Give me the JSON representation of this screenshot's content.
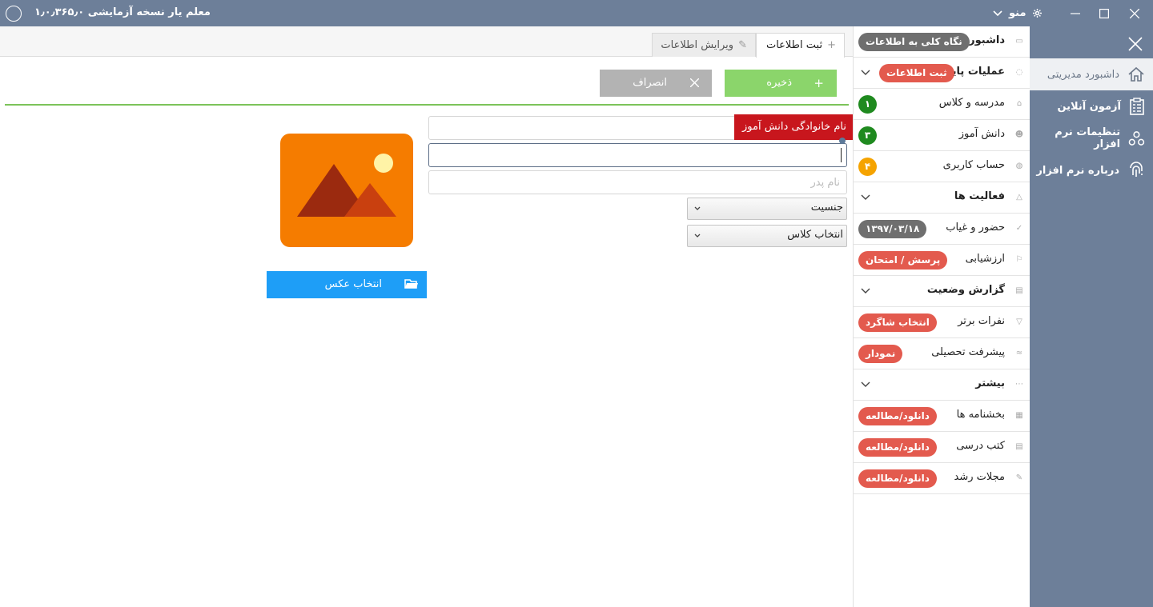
{
  "titlebar": {
    "title": "معلم یار نسخه آزمایشی ۱٫۰٫۳۶۵٫۰",
    "menu_label": "منو"
  },
  "rail": {
    "items": [
      {
        "label": "داشبورد مدیریتی",
        "icon": "home-icon",
        "active": true
      },
      {
        "label": "آزمون آنلاین",
        "icon": "clipboard-icon",
        "active": false
      },
      {
        "label": "تنظیمات نرم افزار",
        "icon": "cogs-icon",
        "active": false
      },
      {
        "label": "درباره نرم افزار",
        "icon": "fingerprint-icon",
        "active": false
      }
    ]
  },
  "sidemenu": {
    "rows": [
      {
        "label": "داشبورد",
        "badge": "نگاه کلی به اطلاعات",
        "badge_color": "gray",
        "head": true
      },
      {
        "label": "عملیات پایه",
        "badge": "ثبت اطلاعات",
        "badge_color": "red",
        "head": true,
        "chevron": true
      },
      {
        "label": "مدرسه و کلاس",
        "badge": "۱",
        "badge_color": "green"
      },
      {
        "label": "دانش آموز",
        "badge": "۳",
        "badge_color": "green"
      },
      {
        "label": "حساب کاربری",
        "badge": "۴",
        "badge_color": "orange"
      },
      {
        "label": "فعالیت ها",
        "head": true,
        "chevron": true
      },
      {
        "label": "حضور و غیاب",
        "badge": "۱۳۹۷/۰۳/۱۸",
        "badge_color": "gray"
      },
      {
        "label": "ارزشیابی",
        "badge": "پرسش / امتحان",
        "badge_color": "red"
      },
      {
        "label": "گزارش وضعیت",
        "head": true,
        "chevron": true
      },
      {
        "label": "نفرات برتر",
        "badge": "انتخاب شاگرد",
        "badge_color": "red"
      },
      {
        "label": "پیشرفت تحصیلی",
        "badge": "نمودار",
        "badge_color": "red"
      },
      {
        "label": "بیشتر",
        "head": true,
        "chevron": true
      },
      {
        "label": "بخشنامه ها",
        "badge": "دانلود/مطالعه",
        "badge_color": "red"
      },
      {
        "label": "کتب درسی",
        "badge": "دانلود/مطالعه",
        "badge_color": "red"
      },
      {
        "label": "مجلات رشد",
        "badge": "دانلود/مطالعه",
        "badge_color": "red"
      }
    ]
  },
  "tabs": {
    "active": "ثبت اطلاعات",
    "inactive": "ویرایش اطلاعات"
  },
  "toolbar": {
    "save_label": "ذخیره",
    "cancel_label": "انصراف"
  },
  "form": {
    "first_name_value": "",
    "last_name_value": "",
    "father_name_placeholder": "نام پدر",
    "tooltip": "نام خانوادگی دانش آموز",
    "gender_selected": "جنسیت",
    "class_selected": "انتخاب کلاس",
    "photo_button_label": "انتخاب عکس"
  },
  "colors": {
    "titlebar": "#6d7f99",
    "save": "#8bd56b",
    "cancel": "#b3b3b3",
    "photo_button": "#1e9ef7",
    "tooltip": "#c8161d",
    "badge_red": "#e35a4e",
    "badge_gray": "#6f6f6f",
    "badge_green": "#1f8a1f",
    "badge_orange": "#f5a300"
  }
}
